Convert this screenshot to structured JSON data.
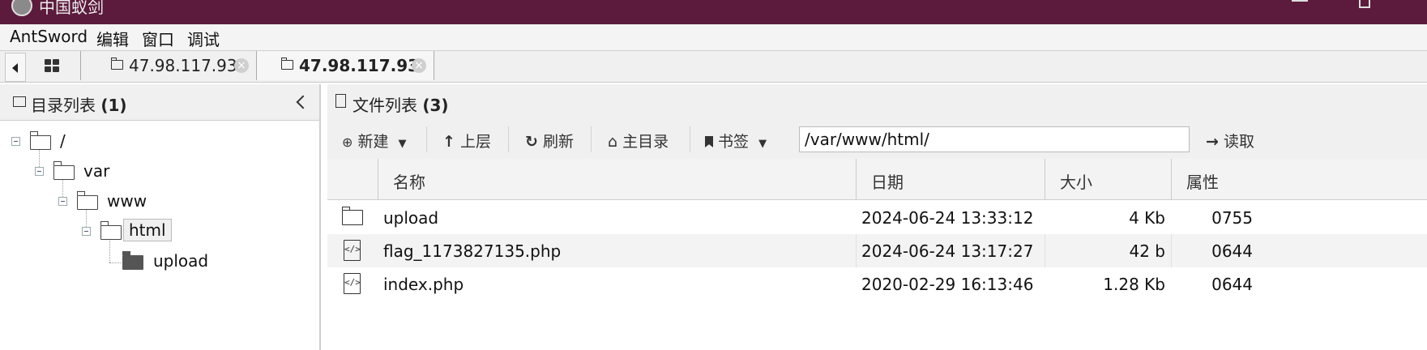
{
  "window": {
    "title": "中国蚁剑"
  },
  "menu": {
    "items": [
      "AntSword",
      "编辑",
      "窗口",
      "调试"
    ]
  },
  "tabs": [
    {
      "label": "47.98.117.93",
      "active": false
    },
    {
      "label": "47.98.117.93",
      "active": true
    }
  ],
  "left_panel": {
    "title": "目录列表",
    "count": "(1)",
    "tree": [
      {
        "label": "/",
        "level": 0
      },
      {
        "label": "var",
        "level": 1
      },
      {
        "label": "www",
        "level": 2
      },
      {
        "label": "html",
        "level": 3,
        "selected": true
      },
      {
        "label": "upload",
        "level": 4
      }
    ]
  },
  "right_panel": {
    "title": "文件列表",
    "count": "(3)",
    "toolbar": {
      "new_label": "新建",
      "up_label": "上层",
      "refresh_label": "刷新",
      "home_label": "主目录",
      "bookmark_label": "书签",
      "path_value": "/var/www/html/",
      "read_label": "读取"
    },
    "columns": [
      "名称",
      "日期",
      "大小",
      "属性"
    ],
    "files": [
      {
        "name": "upload",
        "date": "2024-06-24 13:33:12",
        "size": "4 Kb",
        "perm": "0755",
        "icon": "folder-icon"
      },
      {
        "name": "flag_1173827135.php",
        "date": "2024-06-24 13:17:27",
        "size": "42 b",
        "perm": "0644",
        "icon": "code-file-icon"
      },
      {
        "name": "index.php",
        "date": "2020-02-29 16:13:46",
        "size": "1.28 Kb",
        "perm": "0644",
        "icon": "code-file-icon"
      }
    ]
  },
  "colors": {
    "titlebar": "#5c1a3c"
  }
}
